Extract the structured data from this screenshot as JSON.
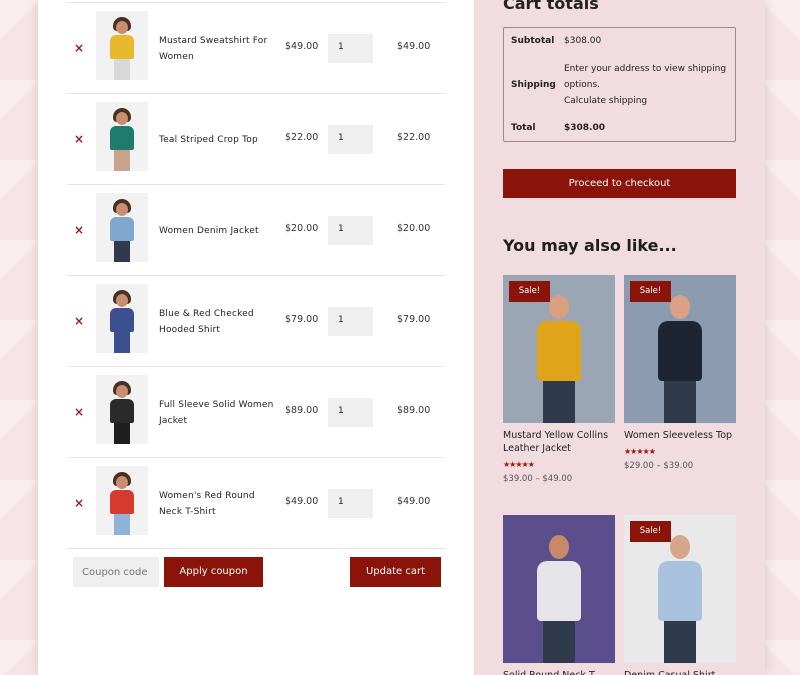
{
  "cart": {
    "items": [
      {
        "name": "Mustard Sweatshirt For Women",
        "price": "$49.00",
        "qty": "1",
        "subtotal": "$49.00",
        "shirt_color": "#e8b92c",
        "leg_color": "#d9d9d9"
      },
      {
        "name": "Teal Striped Crop Top",
        "price": "$22.00",
        "qty": "1",
        "subtotal": "$22.00",
        "shirt_color": "#1f7a70",
        "leg_color": "#c9a48a"
      },
      {
        "name": "Women Denim Jacket",
        "price": "$20.00",
        "qty": "1",
        "subtotal": "$20.00",
        "shirt_color": "#7fa7cf",
        "leg_color": "#2f3a4c"
      },
      {
        "name": "Blue & Red Checked Hooded Shirt",
        "price": "$79.00",
        "qty": "1",
        "subtotal": "$79.00",
        "shirt_color": "#3c4f8f",
        "leg_color": "#3c4f8f"
      },
      {
        "name": "Full Sleeve Solid Women Jacket",
        "price": "$89.00",
        "qty": "1",
        "subtotal": "$89.00",
        "shirt_color": "#2a2a2a",
        "leg_color": "#1e1e1e"
      },
      {
        "name": "Women's Red Round Neck T-Shirt",
        "price": "$49.00",
        "qty": "1",
        "subtotal": "$49.00",
        "shirt_color": "#d63a2e",
        "leg_color": "#8fb3d6"
      }
    ],
    "remove_symbol": "×",
    "coupon_placeholder": "Coupon code",
    "apply_label": "Apply coupon",
    "update_label": "Update cart"
  },
  "totals": {
    "title": "Cart totals",
    "subtotal_label": "Subtotal",
    "subtotal_value": "$308.00",
    "shipping_label": "Shipping",
    "shipping_message": "Enter your address to view shipping options.",
    "calc_label": "Calculate shipping",
    "total_label": "Total",
    "total_value": "$308.00",
    "checkout_label": "Proceed to checkout"
  },
  "related": {
    "title": "You may also like...",
    "products": [
      {
        "name": "Mustard Yellow Collins Leather Jacket",
        "sale": "Sale!",
        "stars": "★★★★★",
        "range": "$39.00 – $49.00",
        "bg": "#9aa6b3",
        "shirt": "#e0a41b",
        "skin": "#d9a07f"
      },
      {
        "name": "Women Sleeveless Top",
        "sale": "Sale!",
        "stars": "★★★★★",
        "range": "$29.00 – $39.00",
        "bg": "#8d9bb0",
        "shirt": "#1d2433",
        "skin": "#dca184"
      },
      {
        "name": "Solid Round Neck T...",
        "sale": "",
        "stars": "",
        "range": "",
        "bg": "#5a4f8c",
        "shirt": "#e6e6ea",
        "skin": "#c8886a"
      },
      {
        "name": "Denim Casual Shirt Slim...",
        "sale": "Sale!",
        "stars": "",
        "range": "",
        "bg": "#e9e9ea",
        "shirt": "#a9c3de",
        "skin": "#d7a58a"
      }
    ]
  },
  "colors": {
    "accent": "#8a1409",
    "sidebar": "#f1dcdf"
  }
}
